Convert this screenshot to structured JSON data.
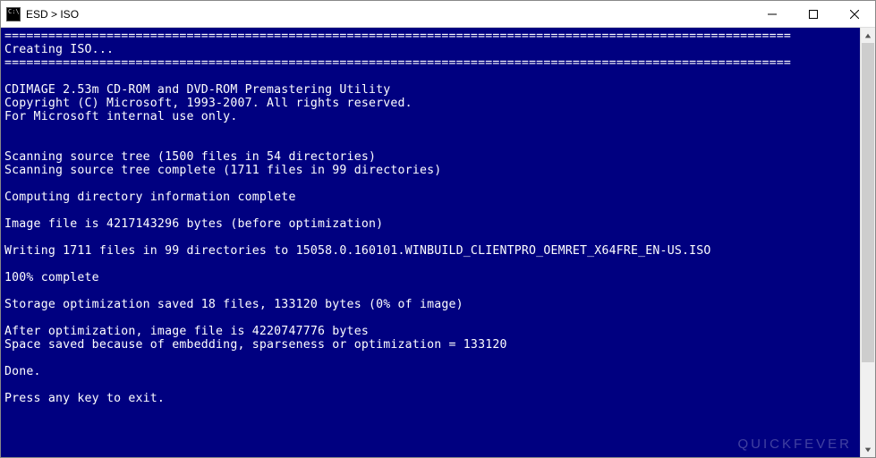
{
  "window": {
    "title": "ESD > ISO"
  },
  "console": {
    "separator": "============================================================================================================",
    "heading": "Creating ISO...",
    "lines": {
      "util1": "CDIMAGE 2.53m CD-ROM and DVD-ROM Premastering Utility",
      "util2": "Copyright (C) Microsoft, 1993-2007. All rights reserved.",
      "util3": "For Microsoft internal use only.",
      "scan1": "Scanning source tree (1500 files in 54 directories)",
      "scan2": "Scanning source tree complete (1711 files in 99 directories)",
      "compute": "Computing directory information complete",
      "imgsize": "Image file is 4217143296 bytes (before optimization)",
      "writing": "Writing 1711 files in 99 directories to 15058.0.160101.WINBUILD_CLIENTPRO_OEMRET_X64FRE_EN-US.ISO",
      "progress": "100% complete",
      "storage": "Storage optimization saved 18 files, 133120 bytes (0% of image)",
      "after1": "After optimization, image file is 4220747776 bytes",
      "after2": "Space saved because of embedding, sparseness or optimization = 133120",
      "done": "Done.",
      "exit": "Press any key to exit."
    }
  },
  "watermark": {
    "part1": "QUICK",
    "part2": "FEVER"
  }
}
